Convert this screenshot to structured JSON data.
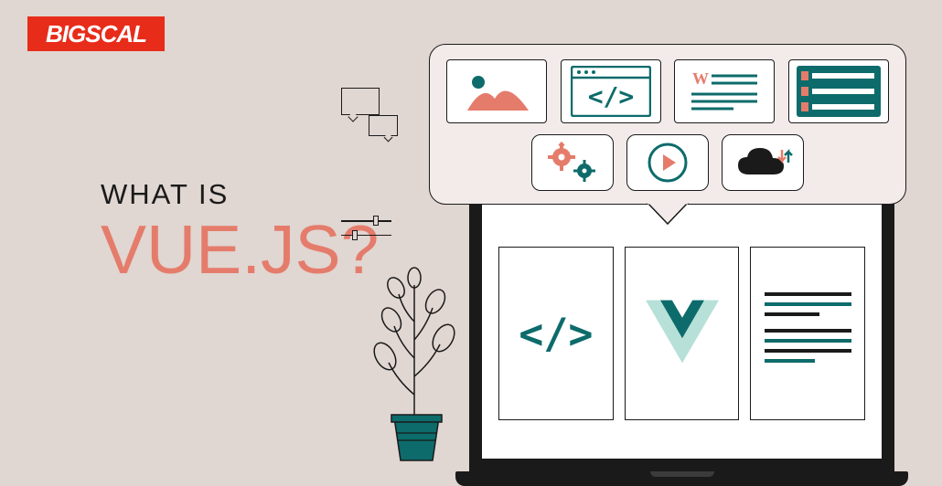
{
  "logo": {
    "text": "BIGSCAL"
  },
  "headline": {
    "line1": "WHAT IS",
    "line2": "VUE.JS?"
  },
  "icons": {
    "image": "image-icon",
    "code": "code-icon",
    "doc": "doc-icon",
    "list": "list-icon",
    "gears": "gears-icon",
    "play": "play-icon",
    "cloud": "cloud-icon"
  },
  "screen": {
    "code_symbol": "</>"
  },
  "colors": {
    "bg": "#e0d6d2",
    "accent": "#e57c6b",
    "teal": "#0d6b6b",
    "dark": "#1a1a1a",
    "red": "#e82c1a"
  }
}
